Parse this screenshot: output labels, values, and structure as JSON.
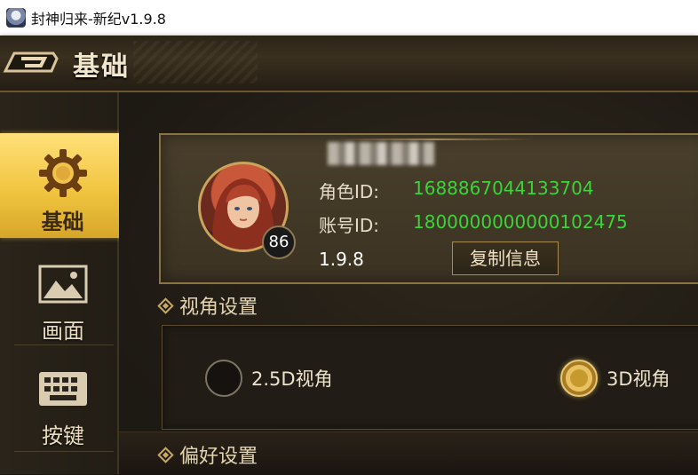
{
  "window": {
    "title": "封神归来-新纪v1.9.8"
  },
  "header": {
    "title": "基础"
  },
  "sidebar": {
    "items": [
      {
        "label": "基础",
        "icon": "gear-icon",
        "active": true
      },
      {
        "label": "画面",
        "icon": "landscape-image-icon",
        "active": false
      },
      {
        "label": "按键",
        "icon": "keyboard-icon",
        "active": false
      }
    ]
  },
  "profile": {
    "level": "86",
    "role_id_label": "角色ID:",
    "role_id": "1688867044133704",
    "account_id_label": "账号ID:",
    "account_id": "1800000000000102475",
    "version": "1.9.8",
    "copy_button": "复制信息"
  },
  "view_settings": {
    "title": "视角设置",
    "options": [
      {
        "label": "2.5D视角",
        "checked": false
      },
      {
        "label": "3D视角",
        "checked": true
      }
    ]
  },
  "preference_settings": {
    "title": "偏好设置"
  },
  "colors": {
    "accent_gold": "#f1c53f",
    "id_green": "#3cd43a"
  }
}
